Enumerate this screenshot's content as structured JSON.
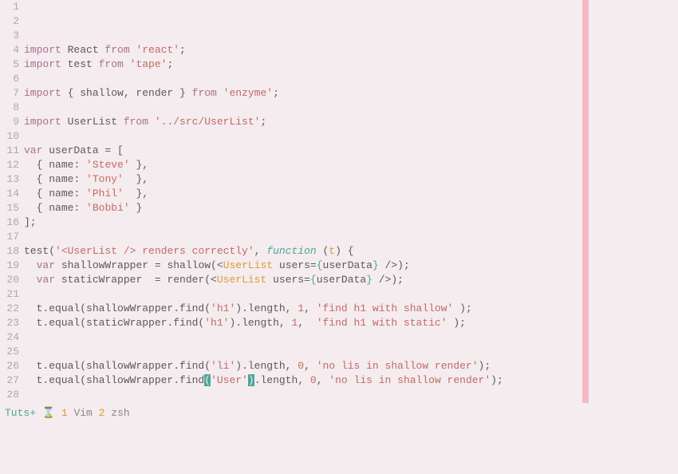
{
  "lines": [
    {
      "n": 1,
      "tokens": [
        {
          "t": "import ",
          "c": "kw"
        },
        {
          "t": "React ",
          "c": "id"
        },
        {
          "t": "from ",
          "c": "kw"
        },
        {
          "t": "'react'",
          "c": "str"
        },
        {
          "t": ";",
          "c": "id"
        }
      ]
    },
    {
      "n": 2,
      "tokens": [
        {
          "t": "import ",
          "c": "kw"
        },
        {
          "t": "test ",
          "c": "id"
        },
        {
          "t": "from ",
          "c": "kw"
        },
        {
          "t": "'tape'",
          "c": "str"
        },
        {
          "t": ";",
          "c": "id"
        }
      ]
    },
    {
      "n": 3,
      "tokens": []
    },
    {
      "n": 4,
      "tokens": [
        {
          "t": "import ",
          "c": "kw"
        },
        {
          "t": "{ shallow, render } ",
          "c": "id"
        },
        {
          "t": "from ",
          "c": "kw"
        },
        {
          "t": "'enzyme'",
          "c": "str"
        },
        {
          "t": ";",
          "c": "id"
        }
      ]
    },
    {
      "n": 5,
      "tokens": []
    },
    {
      "n": 6,
      "tokens": [
        {
          "t": "import ",
          "c": "kw"
        },
        {
          "t": "UserList ",
          "c": "id"
        },
        {
          "t": "from ",
          "c": "kw"
        },
        {
          "t": "'../src/UserList'",
          "c": "str"
        },
        {
          "t": ";",
          "c": "id"
        }
      ]
    },
    {
      "n": 7,
      "tokens": []
    },
    {
      "n": 8,
      "tokens": [
        {
          "t": "var ",
          "c": "kw"
        },
        {
          "t": "userData = [",
          "c": "id"
        }
      ]
    },
    {
      "n": 9,
      "tokens": [
        {
          "t": "  { ",
          "c": "id"
        },
        {
          "t": "name",
          "c": "id"
        },
        {
          "t": ": ",
          "c": "id"
        },
        {
          "t": "'Steve'",
          "c": "str"
        },
        {
          "t": " },",
          "c": "id"
        }
      ]
    },
    {
      "n": 10,
      "tokens": [
        {
          "t": "  { ",
          "c": "id"
        },
        {
          "t": "name",
          "c": "id"
        },
        {
          "t": ": ",
          "c": "id"
        },
        {
          "t": "'Tony'",
          "c": "str"
        },
        {
          "t": "  },",
          "c": "id"
        }
      ]
    },
    {
      "n": 11,
      "tokens": [
        {
          "t": "  { ",
          "c": "id"
        },
        {
          "t": "name",
          "c": "id"
        },
        {
          "t": ": ",
          "c": "id"
        },
        {
          "t": "'Phil'",
          "c": "str"
        },
        {
          "t": "  },",
          "c": "id"
        }
      ]
    },
    {
      "n": 12,
      "tokens": [
        {
          "t": "  { ",
          "c": "id"
        },
        {
          "t": "name",
          "c": "id"
        },
        {
          "t": ": ",
          "c": "id"
        },
        {
          "t": "'Bobbi'",
          "c": "str"
        },
        {
          "t": " }",
          "c": "id"
        }
      ]
    },
    {
      "n": 13,
      "tokens": [
        {
          "t": "];",
          "c": "id"
        }
      ]
    },
    {
      "n": 14,
      "tokens": []
    },
    {
      "n": 15,
      "tokens": [
        {
          "t": "test(",
          "c": "id"
        },
        {
          "t": "'<UserList /> renders correctly'",
          "c": "str"
        },
        {
          "t": ", ",
          "c": "id"
        },
        {
          "t": "function",
          "c": "fn"
        },
        {
          "t": " (",
          "c": "id"
        },
        {
          "t": "t",
          "c": "type"
        },
        {
          "t": ") {",
          "c": "id"
        }
      ]
    },
    {
      "n": 16,
      "tokens": [
        {
          "t": "  ",
          "c": "id"
        },
        {
          "t": "var ",
          "c": "kw"
        },
        {
          "t": "shallowWrapper = shallow(<",
          "c": "id"
        },
        {
          "t": "UserList",
          "c": "type"
        },
        {
          "t": " users=",
          "c": "id"
        },
        {
          "t": "{",
          "c": "brace"
        },
        {
          "t": "userData",
          "c": "id"
        },
        {
          "t": "}",
          "c": "brace"
        },
        {
          "t": " />);",
          "c": "id"
        }
      ]
    },
    {
      "n": 17,
      "tokens": [
        {
          "t": "  ",
          "c": "id"
        },
        {
          "t": "var ",
          "c": "kw"
        },
        {
          "t": "staticWrapper  = render(<",
          "c": "id"
        },
        {
          "t": "UserList",
          "c": "type"
        },
        {
          "t": " users=",
          "c": "id"
        },
        {
          "t": "{",
          "c": "brace"
        },
        {
          "t": "userData",
          "c": "id"
        },
        {
          "t": "}",
          "c": "brace"
        },
        {
          "t": " />);",
          "c": "id"
        }
      ]
    },
    {
      "n": 18,
      "tokens": []
    },
    {
      "n": 19,
      "tokens": [
        {
          "t": "  t.equal(shallowWrapper.find(",
          "c": "id"
        },
        {
          "t": "'h1'",
          "c": "str"
        },
        {
          "t": ").length, ",
          "c": "id"
        },
        {
          "t": "1",
          "c": "num"
        },
        {
          "t": ", ",
          "c": "id"
        },
        {
          "t": "'find h1 with shallow'",
          "c": "str"
        },
        {
          "t": " );",
          "c": "id"
        }
      ]
    },
    {
      "n": 20,
      "tokens": [
        {
          "t": "  t.equal(staticWrapper.find(",
          "c": "id"
        },
        {
          "t": "'h1'",
          "c": "str"
        },
        {
          "t": ").length, ",
          "c": "id"
        },
        {
          "t": "1",
          "c": "num"
        },
        {
          "t": ",  ",
          "c": "id"
        },
        {
          "t": "'find h1 with static'",
          "c": "str"
        },
        {
          "t": " );",
          "c": "id"
        }
      ]
    },
    {
      "n": 21,
      "tokens": []
    },
    {
      "n": 22,
      "tokens": []
    },
    {
      "n": 23,
      "tokens": [
        {
          "t": "  t.equal(shallowWrapper.find(",
          "c": "id"
        },
        {
          "t": "'li'",
          "c": "str"
        },
        {
          "t": ").length, ",
          "c": "id"
        },
        {
          "t": "0",
          "c": "num"
        },
        {
          "t": ", ",
          "c": "id"
        },
        {
          "t": "'no lis in shallow render'",
          "c": "str"
        },
        {
          "t": ");",
          "c": "id"
        }
      ]
    },
    {
      "n": 24,
      "tokens": [
        {
          "t": "  t.equal(shallowWrapper.find",
          "c": "id"
        },
        {
          "t": "(",
          "c": "cursor-match"
        },
        {
          "t": "'User'",
          "c": "str"
        },
        {
          "t": ")",
          "c": "cursor-match"
        },
        {
          "t": ".length, ",
          "c": "id"
        },
        {
          "t": "0",
          "c": "num"
        },
        {
          "t": ", ",
          "c": "id"
        },
        {
          "t": "'no lis in shallow render'",
          "c": "str"
        },
        {
          "t": ");",
          "c": "id"
        }
      ]
    },
    {
      "n": 25,
      "tokens": []
    },
    {
      "n": 26,
      "tokens": []
    },
    {
      "n": 27,
      "tokens": []
    },
    {
      "n": 28,
      "tokens": []
    }
  ],
  "status": {
    "session": "Tuts+",
    "hourglass": "⌛",
    "win1_idx": "1",
    "win1_name": "Vim",
    "win2_idx": "2",
    "win2_name": "zsh"
  }
}
